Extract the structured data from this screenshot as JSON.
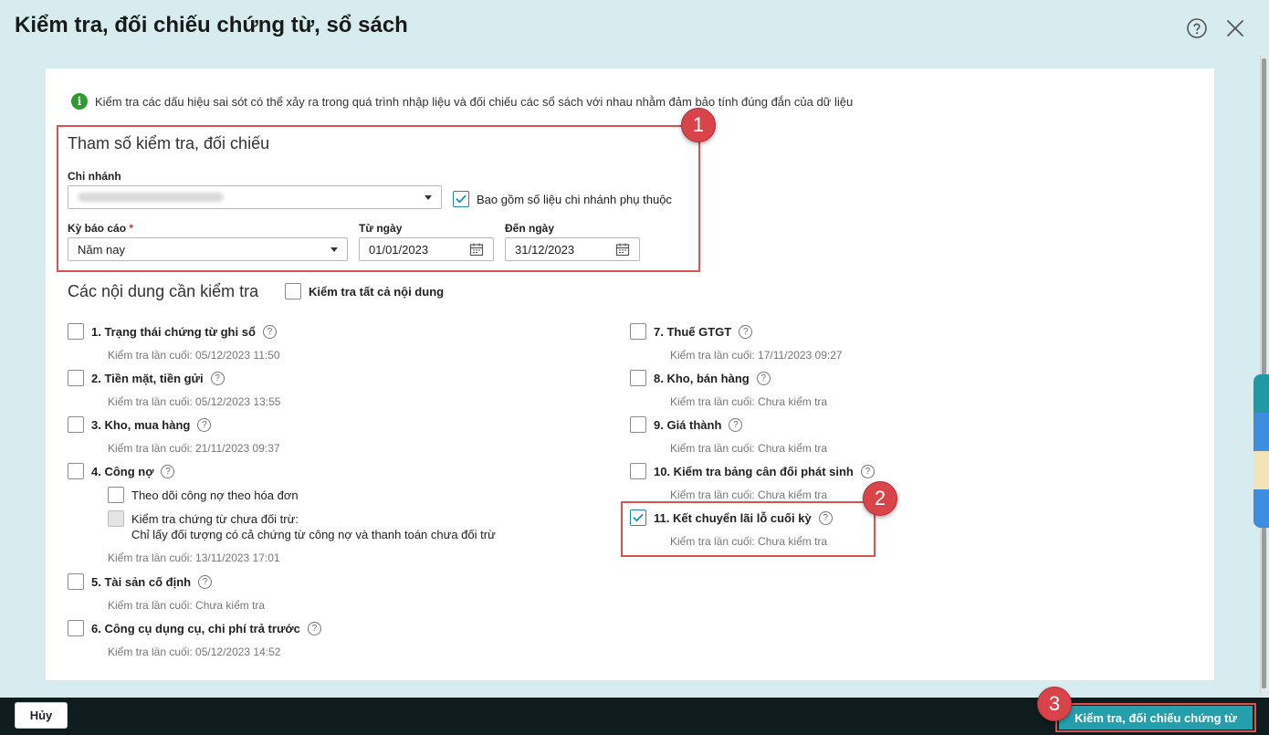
{
  "dialog": {
    "title": "Kiểm tra, đối chiếu chứng từ, sổ sách"
  },
  "info_text": "Kiểm tra các dấu hiệu sai sót có thể xảy ra trong quá trình nhập liệu và đối chiếu các sổ sách với nhau nhằm đảm bảo tính đúng đắn của dữ liệu",
  "params": {
    "title": "Tham số kiểm tra, đối chiếu",
    "branch_label": "Chi nhánh",
    "include_dependent_label": "Bao gồm số liệu chi nhánh phụ thuộc",
    "include_dependent_checked": true,
    "period_label": "Kỳ báo cáo",
    "required_mark": "*",
    "period_value": "Năm nay",
    "from_label": "Từ ngày",
    "from_value": "01/01/2023",
    "to_label": "Đến ngày",
    "to_value": "31/12/2023"
  },
  "contents": {
    "title": "Các nội dung cần kiểm tra",
    "check_all_label": "Kiểm tra tất cả nội dung",
    "left": [
      {
        "label": "1. Trạng thái chứng từ ghi sổ",
        "last": "Kiểm tra lần cuối: 05/12/2023 11:50"
      },
      {
        "label": "2. Tiền mặt, tiền gửi",
        "last": "Kiểm tra lần cuối: 05/12/2023 13:55"
      },
      {
        "label": "3. Kho, mua hàng",
        "last": "Kiểm tra lần cuối: 21/11/2023 09:37"
      },
      {
        "label": "4. Công nợ",
        "last": "Kiểm tra lần cuối: 13/11/2023 17:01"
      },
      {
        "label": "5. Tài sản cố định",
        "last": "Kiểm tra lần cuối: Chưa kiểm tra"
      },
      {
        "label": "6. Công cụ dụng cụ, chi phí trả trước",
        "last": "Kiểm tra lần cuối: 05/12/2023 14:52"
      }
    ],
    "debt_sub": {
      "opt1": "Theo dõi công nợ theo hóa đơn",
      "opt2_line1": "Kiểm tra chứng từ chưa đối trừ:",
      "opt2_line2": "Chỉ lấy đối tượng có cả chứng từ công nợ và thanh toán chưa đối trừ"
    },
    "right": [
      {
        "label": "7. Thuế GTGT",
        "last": "Kiểm tra lần cuối: 17/11/2023 09:27",
        "checked": false
      },
      {
        "label": "8. Kho, bán hàng",
        "last": "Kiểm tra lần cuối: Chưa kiểm tra",
        "checked": false
      },
      {
        "label": "9. Giá thành",
        "last": "Kiểm tra lần cuối: Chưa kiểm tra",
        "checked": false
      },
      {
        "label": "10. Kiểm tra bảng cân đối phát sinh",
        "last": "Kiểm tra lần cuối: Chưa kiểm tra",
        "checked": false
      },
      {
        "label": "11. Kết chuyển lãi lỗ cuối kỳ",
        "last": "Kiểm tra lần cuối: Chưa kiểm tra",
        "checked": true
      }
    ]
  },
  "badges": [
    "1",
    "2",
    "3"
  ],
  "footer": {
    "cancel_label": "Hủy",
    "primary_label": "Kiểm tra, đối chiếu chứng từ"
  },
  "colors": {
    "accent": "#24a0ad",
    "highlight": "#d9534f",
    "badge": "#d9444b",
    "footer_bg": "#0f1d1f"
  }
}
